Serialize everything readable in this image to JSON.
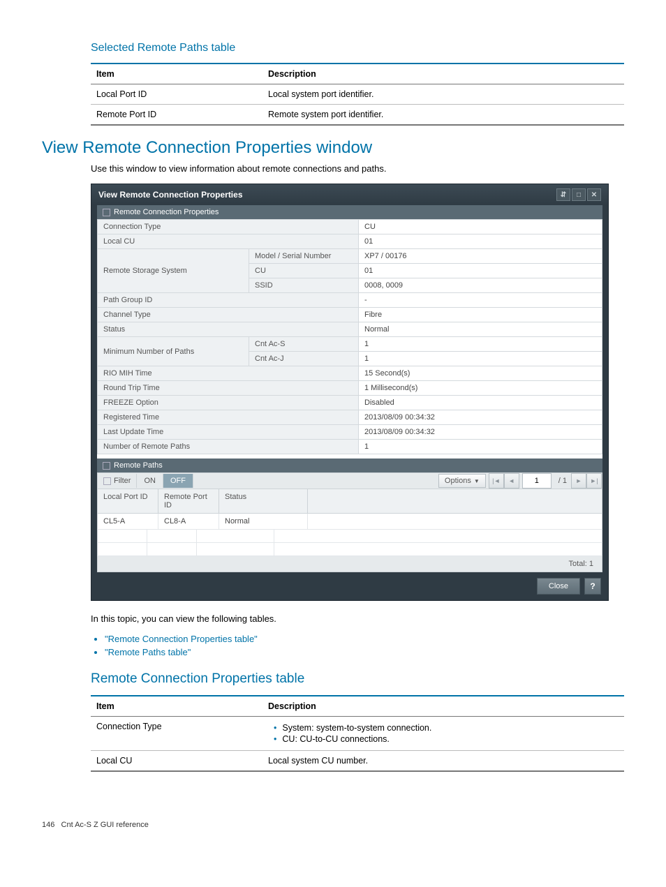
{
  "sec1": {
    "title": "Selected Remote Paths table",
    "headers": [
      "Item",
      "Description"
    ],
    "rows": [
      [
        "Local Port ID",
        "Local system port identifier."
      ],
      [
        "Remote Port ID",
        "Remote system port identifier."
      ]
    ]
  },
  "sec2": {
    "title": "View Remote Connection Properties window",
    "intro": "Use this window to view information about remote connections and paths."
  },
  "dlg": {
    "title": "View Remote Connection Properties",
    "sec_props": "Remote Connection Properties",
    "rows": {
      "conn_type_l": "Connection Type",
      "conn_type_v": "CU",
      "local_cu_l": "Local CU",
      "local_cu_v": "01",
      "rss_l": "Remote Storage System",
      "rss_model_l": "Model / Serial Number",
      "rss_model_v": "XP7 / 00176",
      "rss_cu_l": "CU",
      "rss_cu_v": "01",
      "rss_ssid_l": "SSID",
      "rss_ssid_v": "0008, 0009",
      "pgid_l": "Path Group ID",
      "pgid_v": "-",
      "chtype_l": "Channel Type",
      "chtype_v": "Fibre",
      "status_l": "Status",
      "status_v": "Normal",
      "minpaths_l": "Minimum Number of Paths",
      "minpaths_s_l": "Cnt Ac-S",
      "minpaths_s_v": "1",
      "minpaths_j_l": "Cnt Ac-J",
      "minpaths_j_v": "1",
      "rio_l": "RIO MIH Time",
      "rio_v": "15 Second(s)",
      "rtt_l": "Round Trip Time",
      "rtt_v": "1 Millisecond(s)",
      "freeze_l": "FREEZE Option",
      "freeze_v": "Disabled",
      "reg_l": "Registered Time",
      "reg_v": "2013/08/09 00:34:32",
      "lut_l": "Last Update Time",
      "lut_v": "2013/08/09 00:34:32",
      "nrp_l": "Number of Remote Paths",
      "nrp_v": "1"
    },
    "sec_paths": "Remote Paths",
    "filter": {
      "label": "Filter",
      "on": "ON",
      "off": "OFF",
      "options": "Options",
      "page": "1",
      "total": "/ 1"
    },
    "grid": {
      "h1": "Local Port ID",
      "h2": "Remote Port ID",
      "h3": "Status",
      "r1c1": "CL5-A",
      "r1c2": "CL8-A",
      "r1c3": "Normal"
    },
    "total_label": "Total:  1",
    "close": "Close"
  },
  "after": {
    "intro": "In this topic, you can view the following tables.",
    "link1": "\"Remote Connection Properties table\"",
    "link2": "\"Remote Paths table\""
  },
  "sec3": {
    "title": "Remote Connection Properties table",
    "headers": [
      "Item",
      "Description"
    ],
    "rows": {
      "r1c1": "Connection Type",
      "r1b1": "System: system-to-system connection.",
      "r1b2": "CU: CU-to-CU connections.",
      "r2c1": "Local CU",
      "r2c2": "Local system CU number."
    }
  },
  "footer": {
    "page": "146",
    "chapter": "Cnt Ac-S Z GUI reference"
  }
}
